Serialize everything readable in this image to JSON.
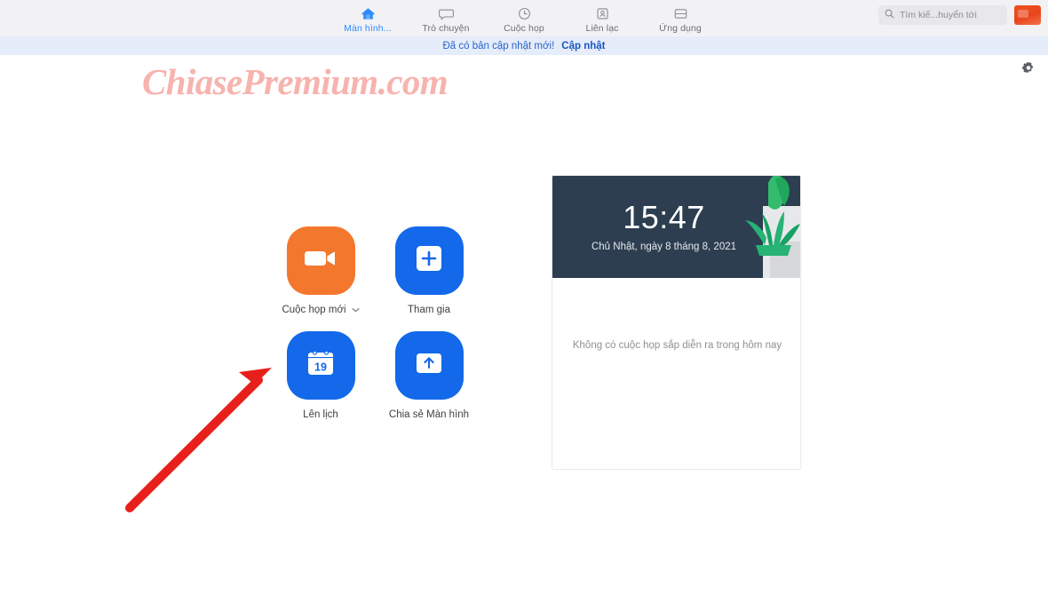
{
  "header": {
    "nav": [
      {
        "label": "Màn hình...",
        "icon": "home-icon",
        "active": true
      },
      {
        "label": "Trò chuyện",
        "icon": "chat-bubble-icon",
        "active": false
      },
      {
        "label": "Cuộc họp",
        "icon": "clock-icon",
        "active": false
      },
      {
        "label": "Liên lạc",
        "icon": "contacts-icon",
        "active": false
      },
      {
        "label": "Ứng dụng",
        "icon": "apps-icon",
        "active": false
      }
    ],
    "search": {
      "value": "Tìm kiế...huyển tới",
      "icon": "search-icon"
    },
    "avatar": {
      "name": "user-avatar",
      "color": "#ef5023"
    }
  },
  "banner": {
    "message": "Đã có bản cập nhật mới!",
    "link": "Cập nhật",
    "bg": "#e5ecfa",
    "text_color": "#2b64c8"
  },
  "settings": {
    "icon": "gear-icon"
  },
  "watermark": {
    "text": "ChiasePremium.com",
    "color": "#f7b3ae"
  },
  "actions": [
    {
      "label": "Cuộc họp mới",
      "icon": "video-camera-icon",
      "color": "#f4772e",
      "has_caret": true,
      "caret": "⌄"
    },
    {
      "label": "Tham gia",
      "icon": "plus-square-icon",
      "color": "#1369e9",
      "has_caret": false
    },
    {
      "label": "Lên lịch",
      "icon": "calendar-icon",
      "color": "#1369e9",
      "has_caret": false,
      "calendar_day": "19"
    },
    {
      "label": "Chia sẻ Màn hình",
      "icon": "share-screen-up-arrow-icon",
      "color": "#1369e9",
      "has_caret": false
    }
  ],
  "card": {
    "clock": {
      "time": "15:47",
      "date": "Chủ Nhật, ngày 8 tháng 8, 2021",
      "bg": "#2d3e50"
    },
    "empty_state": "Không có cuộc họp sắp diễn ra trong hôm nay",
    "plant_icon": "potted-plant-illustration"
  },
  "annotation": {
    "arrow": "red-arrow-pointing-to-schedule",
    "color": "#e8201c"
  }
}
